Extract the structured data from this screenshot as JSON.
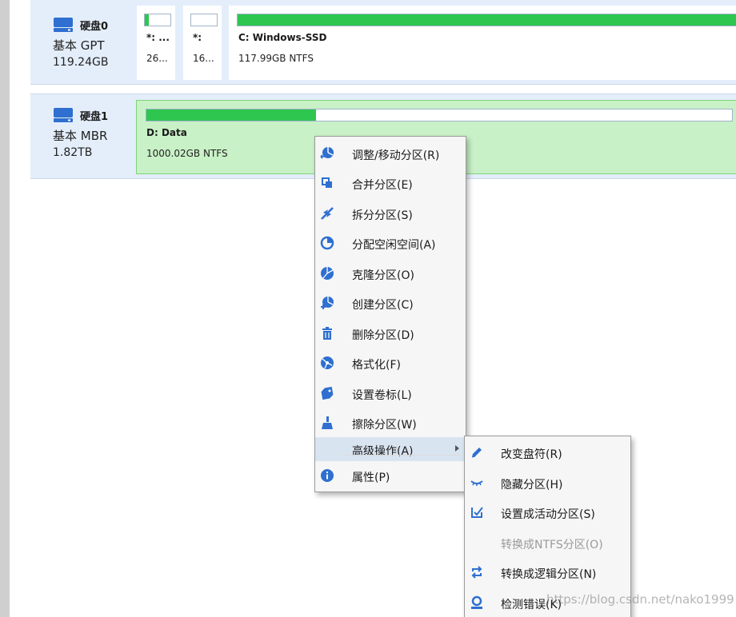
{
  "disks": [
    {
      "name": "硬盘0",
      "type": "基本 GPT",
      "size": "119.24GB",
      "partitions": [
        {
          "label": "*: ...",
          "detail": "26...",
          "usage": 0.15
        },
        {
          "label": "*:",
          "detail": "16...",
          "usage": 0.0
        },
        {
          "label": "C: Windows-SSD",
          "detail": "117.99GB NTFS",
          "usage": 0.98
        }
      ]
    },
    {
      "name": "硬盘1",
      "type": "基本 MBR",
      "size": "1.82TB",
      "partitions": [
        {
          "label": "D: Data",
          "detail": "1000.02GB NTFS",
          "usage": 0.29
        }
      ]
    }
  ],
  "context_menu": {
    "items": [
      {
        "label": "调整/移动分区(R)",
        "icon": "resize-move-icon"
      },
      {
        "label": "合并分区(E)",
        "icon": "merge-icon"
      },
      {
        "label": "拆分分区(S)",
        "icon": "split-icon"
      },
      {
        "label": "分配空闲空间(A)",
        "icon": "allocate-space-icon"
      },
      {
        "label": "克隆分区(O)",
        "icon": "clone-icon"
      },
      {
        "label": "创建分区(C)",
        "icon": "create-icon"
      },
      {
        "label": "删除分区(D)",
        "icon": "delete-icon"
      },
      {
        "label": "格式化(F)",
        "icon": "format-icon"
      },
      {
        "label": "设置卷标(L)",
        "icon": "label-tag-icon"
      },
      {
        "label": "擦除分区(W)",
        "icon": "wipe-icon"
      },
      {
        "label": "高级操作(A)",
        "icon": "",
        "active": true
      },
      {
        "label": "属性(P)",
        "icon": "info-icon"
      }
    ]
  },
  "submenu": {
    "items": [
      {
        "label": "改变盘符(R)",
        "icon": "pencil-icon"
      },
      {
        "label": "隐藏分区(H)",
        "icon": "hide-eye-icon"
      },
      {
        "label": "设置成活动分区(S)",
        "icon": "set-active-icon"
      },
      {
        "label": "转换成NTFS分区(O)",
        "icon": "",
        "disabled": true
      },
      {
        "label": "转换成逻辑分区(N)",
        "icon": "convert-icon"
      },
      {
        "label": "检测错误(K)",
        "icon": "check-error-icon"
      }
    ]
  },
  "watermark": "https://blog.csdn.net/nako1999",
  "colors": {
    "accent": "#2e6fd0",
    "bar_fill": "#2fc64f",
    "disk_row_bg": "#e4eefb",
    "selected_partition_bg": "#c9f1c7"
  }
}
